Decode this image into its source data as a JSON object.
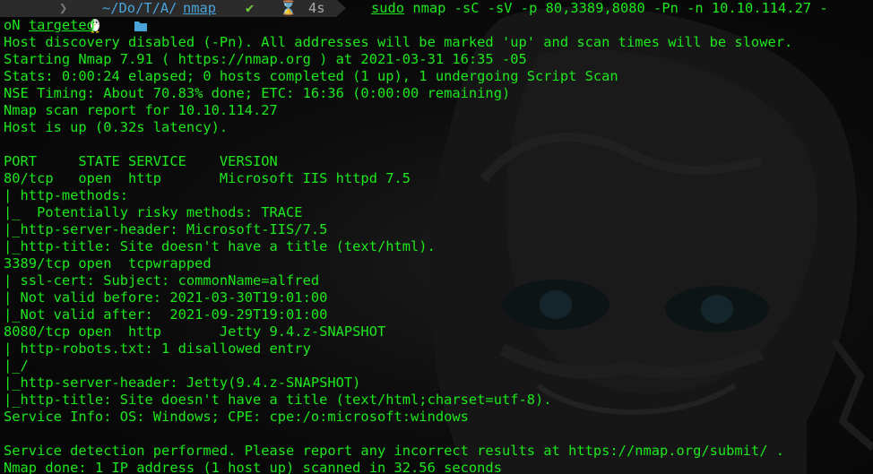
{
  "prompt": {
    "os_icon": "linux-tux-icon",
    "folder_icon": "folder-icon",
    "path_prefix": "~/Do/T/A/",
    "path_current": "nmap",
    "status_icon": "check-icon",
    "timer_icon": "hourglass-icon",
    "duration": "4s",
    "sudo": "sudo",
    "command": " nmap -sC -sV -p 80,3389,8080 -Pn -n 10.10.114.27 -"
  },
  "output_lines": [
    {
      "pre": "oN ",
      "ul": "targeted"
    },
    {
      "pre": "Host discovery disabled (-Pn). All addresses will be marked 'up' and scan times will be slower."
    },
    {
      "pre": "Starting Nmap 7.91 ( https://nmap.org ) at 2021-03-31 16:35 -05"
    },
    {
      "pre": "Stats: 0:00:24 elapsed; 0 hosts completed (1 up), 1 undergoing Script Scan"
    },
    {
      "pre": "NSE Timing: About 70.83% done; ETC: 16:36 (0:00:00 remaining)"
    },
    {
      "pre": "Nmap scan report for 10.10.114.27"
    },
    {
      "pre": "Host is up (0.32s latency)."
    },
    {
      "pre": ""
    },
    {
      "pre": "PORT     STATE SERVICE    VERSION"
    },
    {
      "pre": "80/tcp   open  http       Microsoft IIS httpd 7.5"
    },
    {
      "pre": "| http-methods:"
    },
    {
      "pre": "|_  Potentially risky methods: TRACE"
    },
    {
      "pre": "|_http-server-header: Microsoft-IIS/7.5"
    },
    {
      "pre": "|_http-title: Site doesn't have a title (text/html)."
    },
    {
      "pre": "3389/tcp open  tcpwrapped"
    },
    {
      "pre": "| ssl-cert: Subject: commonName=alfred"
    },
    {
      "pre": "| Not valid before: 2021-03-30T19:01:00"
    },
    {
      "pre": "|_Not valid after:  2021-09-29T19:01:00"
    },
    {
      "pre": "8080/tcp open  http       Jetty 9.4.z-SNAPSHOT"
    },
    {
      "pre": "| http-robots.txt: 1 disallowed entry"
    },
    {
      "pre": "|_/"
    },
    {
      "pre": "|_http-server-header: Jetty(9.4.z-SNAPSHOT)"
    },
    {
      "pre": "|_http-title: Site doesn't have a title (text/html;charset=utf-8)."
    },
    {
      "pre": "Service Info: OS: Windows; CPE: cpe:/o:microsoft:windows"
    },
    {
      "pre": ""
    },
    {
      "pre": "Service detection performed. Please report any incorrect results at https://nmap.org/submit/ ."
    },
    {
      "pre": "Nmap done: 1 IP address (1 host up) scanned in 32.56 seconds"
    }
  ],
  "colors": {
    "text": "#1de81d",
    "prompt_bg": "#2b2b2b",
    "path": "#4aa3d8",
    "check": "#6fcf3a",
    "muted": "#a8a8a8"
  }
}
